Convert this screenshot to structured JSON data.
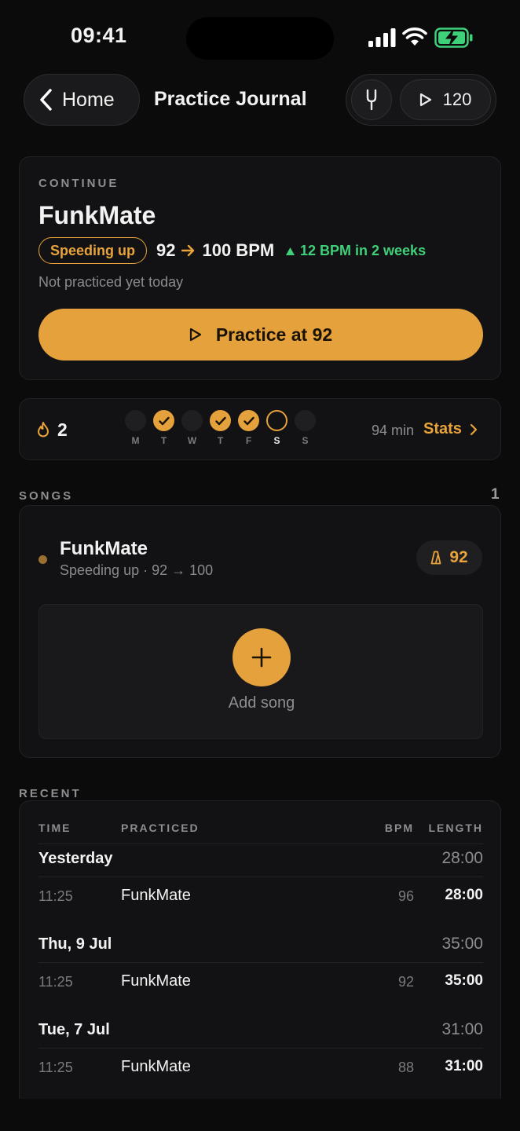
{
  "status_bar": {
    "time": "09:41"
  },
  "header": {
    "back_label": "Home",
    "title": "Practice Journal",
    "tempo": "120"
  },
  "continue": {
    "eyebrow": "CONTINUE",
    "song": "FunkMate",
    "status_chip": "Speeding up",
    "bpm_from": "92",
    "bpm_to": "100 BPM",
    "trend": "12 BPM in 2 weeks",
    "note": "Not practiced yet today",
    "cta_label": "Practice at 92"
  },
  "streak": {
    "count": "2",
    "days": [
      {
        "label": "M",
        "state": "empty"
      },
      {
        "label": "T",
        "state": "done"
      },
      {
        "label": "W",
        "state": "empty"
      },
      {
        "label": "T",
        "state": "done"
      },
      {
        "label": "F",
        "state": "done"
      },
      {
        "label": "S",
        "state": "today"
      },
      {
        "label": "S",
        "state": "empty"
      }
    ],
    "minutes": "94 min",
    "stats_label": "Stats"
  },
  "songs": {
    "eyebrow": "SONGS",
    "count": "1",
    "items": [
      {
        "title": "FunkMate",
        "subtitle": "Speeding up · 92 → 100",
        "bpm": "92"
      }
    ],
    "add_label": "Add song"
  },
  "recent": {
    "eyebrow": "RECENT",
    "columns": {
      "time": "TIME",
      "practiced": "PRACTICED",
      "bpm": "BPM",
      "length": "LENGTH"
    },
    "groups": [
      {
        "date": "Yesterday",
        "total": "28:00",
        "sessions": [
          {
            "time": "11:25",
            "song": "FunkMate",
            "bpm": "96",
            "length": "28:00"
          }
        ]
      },
      {
        "date": "Thu, 9 Jul",
        "total": "35:00",
        "sessions": [
          {
            "time": "11:25",
            "song": "FunkMate",
            "bpm": "92",
            "length": "35:00"
          }
        ]
      },
      {
        "date": "Tue, 7 Jul",
        "total": "31:00",
        "sessions": [
          {
            "time": "11:25",
            "song": "FunkMate",
            "bpm": "88",
            "length": "31:00"
          }
        ]
      }
    ]
  },
  "colors": {
    "accent": "#e5a13c",
    "trend_green": "#3fd07a",
    "background": "#0b0b0c",
    "card": "#121214"
  }
}
